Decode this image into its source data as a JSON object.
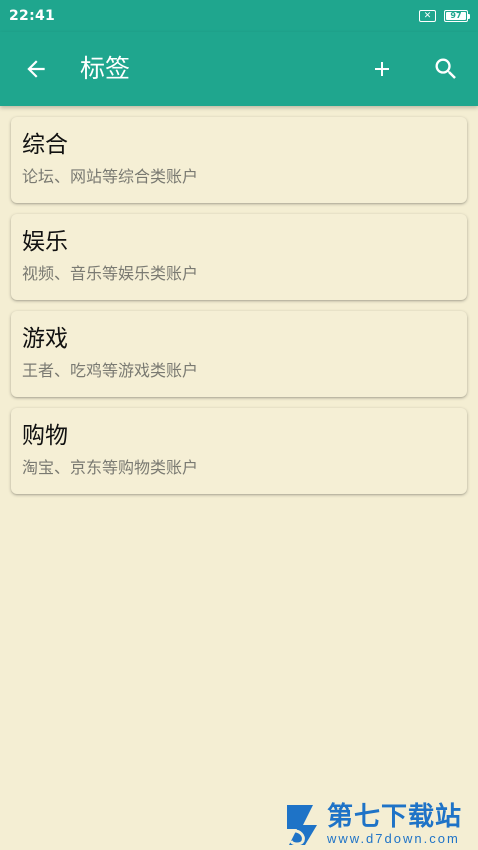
{
  "status_bar": {
    "time": "22:41",
    "sim_icon": "sim-none-icon",
    "battery_level": "97"
  },
  "app_bar": {
    "title": "标签",
    "back_icon": "arrow-back-icon",
    "add_icon": "plus-icon",
    "search_icon": "search-icon",
    "background_color": "#1fa68e"
  },
  "tags": [
    {
      "name": "综合",
      "description": "论坛、网站等综合类账户"
    },
    {
      "name": "娱乐",
      "description": "视频、音乐等娱乐类账户"
    },
    {
      "name": "游戏",
      "description": "王者、吃鸡等游戏类账户"
    },
    {
      "name": "购物",
      "description": "淘宝、京东等购物类账户"
    }
  ],
  "watermark": {
    "name": "第七下载站",
    "url": "www.d7down.com"
  },
  "colors": {
    "background": "#f4eed3",
    "accent": "#1fa68e",
    "watermark": "#1e73c7"
  }
}
